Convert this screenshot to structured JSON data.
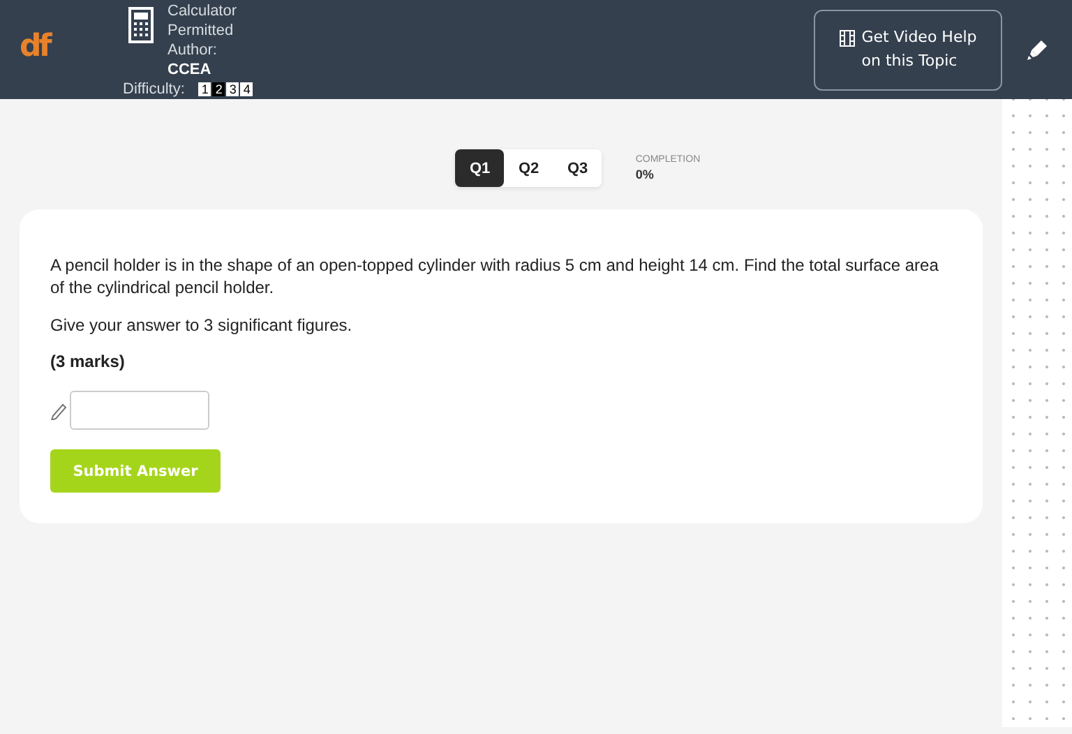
{
  "header": {
    "logo": "df",
    "calculator": "Calculator\nPermitted",
    "author_label": "Author:",
    "author": "CCEA",
    "difficulty_label": "Difficulty:",
    "difficulty": [
      {
        "label": "1",
        "selected": false
      },
      {
        "label": "2",
        "selected": true
      },
      {
        "label": "3",
        "selected": false
      },
      {
        "label": "4",
        "selected": false
      }
    ],
    "video_button": "Get Video Help\non this Topic"
  },
  "tabs": [
    {
      "label": "Q1",
      "selected": true
    },
    {
      "label": "Q2",
      "selected": false
    },
    {
      "label": "Q3",
      "selected": false
    }
  ],
  "completion": {
    "label": "COMPLETION",
    "value": "0%"
  },
  "question": {
    "paragraphs": [
      "A pencil holder is in the shape of an open-topped cylinder with radius 5 cm and height 14 cm. Find the total surface area of the cylindrical pencil holder.",
      "Give your answer to 3 significant figures."
    ],
    "marks": "(3 marks)",
    "submit": "Submit Answer"
  }
}
